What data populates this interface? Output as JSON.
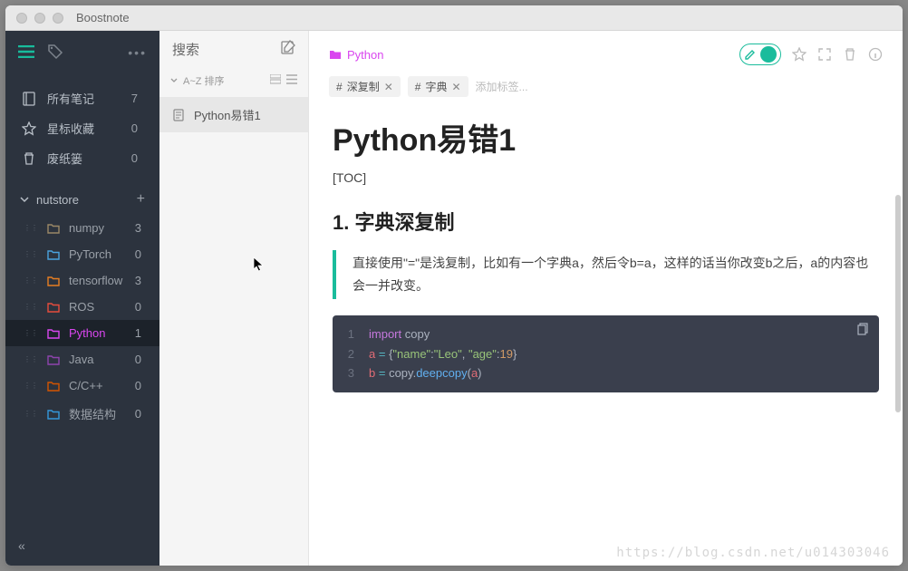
{
  "window": {
    "title": "Boostnote"
  },
  "sidebar": {
    "all_notes": "所有笔记",
    "all_count": 7,
    "starred": "星标收藏",
    "starred_count": 0,
    "trash": "废纸篓",
    "trash_count": 0,
    "storage": "nutstore",
    "folders": [
      {
        "name": "numpy",
        "count": 3,
        "color": "#9a8866"
      },
      {
        "name": "PyTorch",
        "count": 0,
        "color": "#4aa3df"
      },
      {
        "name": "tensorflow",
        "count": 3,
        "color": "#e67e22"
      },
      {
        "name": "ROS",
        "count": 0,
        "color": "#e74c3c"
      },
      {
        "name": "Python",
        "count": 1,
        "color": "#d946ef",
        "active": true
      },
      {
        "name": "Java",
        "count": 0,
        "color": "#8e44ad"
      },
      {
        "name": "C/C++",
        "count": 0,
        "color": "#d35400"
      },
      {
        "name": "数据结构",
        "count": 0,
        "color": "#3498db"
      }
    ]
  },
  "notelist": {
    "search": "搜索",
    "sort": "A~Z 排序",
    "items": [
      {
        "title": "Python易错1"
      }
    ]
  },
  "editor": {
    "folder": "Python",
    "tags": [
      "深复制",
      "字典"
    ],
    "add_tag_placeholder": "添加标签...",
    "title": "Python易错1",
    "toc": "[TOC]",
    "h2": "1. 字典深复制",
    "quote": "直接使用\"=\"是浅复制，比如有一个字典a，然后令b=a，这样的话当你改变b之后，a的内容也会一并改变。",
    "code": {
      "l1": {
        "kw": "import",
        "sp": " ",
        "mod": "copy"
      },
      "l2": {
        "id": "a",
        "sp1": " ",
        "op": "=",
        "sp2": " ",
        "br1": "{",
        "s1": "\"name\"",
        "c1": ":",
        "s2": "\"Leo\"",
        "cm": ", ",
        "s3": "\"age\"",
        "c2": ":",
        "n": "19",
        "br2": "}"
      },
      "l3": {
        "id": "b",
        "sp1": " ",
        "op": "=",
        "sp2": " ",
        "mod": "copy",
        "dot": ".",
        "fn": "deepcopy",
        "p1": "(",
        "arg": "a",
        "p2": ")"
      }
    }
  },
  "watermark": "https://blog.csdn.net/u014303046"
}
